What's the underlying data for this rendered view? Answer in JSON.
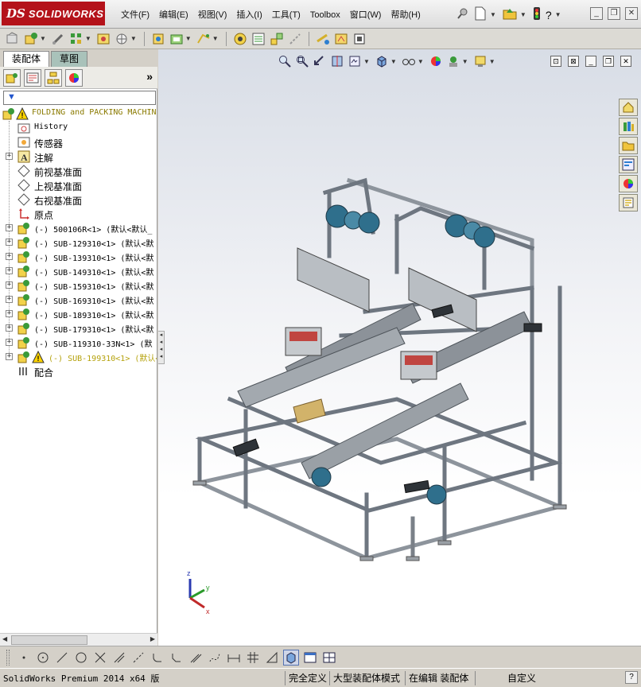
{
  "app": {
    "logo_ds": "DS",
    "logo_text": "SOLIDWORKS"
  },
  "menu": {
    "items": [
      {
        "label": "文件(F)"
      },
      {
        "label": "编辑(E)"
      },
      {
        "label": "视图(V)"
      },
      {
        "label": "插入(I)"
      },
      {
        "label": "工具(T)"
      },
      {
        "label": "Toolbox"
      },
      {
        "label": "窗口(W)"
      },
      {
        "label": "帮助(H)"
      }
    ]
  },
  "left_panel": {
    "tabs": [
      {
        "label": "装配体"
      },
      {
        "label": "草图"
      }
    ],
    "more_label": "»",
    "tree": [
      {
        "label": "FOLDING and PACKING MACHINE",
        "icon": "assembly-icon",
        "warning": true,
        "root": true
      },
      {
        "label": "History",
        "icon": "history-icon"
      },
      {
        "label": "传感器",
        "icon": "sensor-icon"
      },
      {
        "label": "注解",
        "icon": "annotation-icon",
        "expandable": true
      },
      {
        "label": "前视基准面",
        "icon": "plane-icon"
      },
      {
        "label": "上视基准面",
        "icon": "plane-icon"
      },
      {
        "label": "右视基准面",
        "icon": "plane-icon"
      },
      {
        "label": "原点",
        "icon": "origin-icon"
      },
      {
        "label": "(-) 500106R<1> (默认<默认_",
        "icon": "subassembly-icon",
        "expandable": true
      },
      {
        "label": "(-) SUB-129310<1> (默认<默",
        "icon": "subassembly-icon",
        "expandable": true
      },
      {
        "label": "(-) SUB-139310<1> (默认<默",
        "icon": "subassembly-icon",
        "expandable": true
      },
      {
        "label": "(-) SUB-149310<1> (默认<默",
        "icon": "subassembly-icon",
        "expandable": true
      },
      {
        "label": "(-) SUB-159310<1> (默认<默",
        "icon": "subassembly-icon",
        "expandable": true
      },
      {
        "label": "(-) SUB-169310<1> (默认<默",
        "icon": "subassembly-icon",
        "expandable": true
      },
      {
        "label": "(-) SUB-189310<1> (默认<默",
        "icon": "subassembly-icon",
        "expandable": true
      },
      {
        "label": "(-) SUB-179310<1> (默认<默",
        "icon": "subassembly-icon",
        "expandable": true
      },
      {
        "label": "(-) SUB-119310-33N<1> (默",
        "icon": "subassembly-icon",
        "expandable": true
      },
      {
        "label": "(-) SUB-199310<1> (默认<",
        "icon": "subassembly-icon",
        "expandable": true,
        "warning": true
      },
      {
        "label": "配合",
        "icon": "mates-icon"
      }
    ]
  },
  "triad": {
    "x": "x",
    "y": "y",
    "z": "z"
  },
  "status_bar": {
    "app_version": "SolidWorks Premium 2014 x64 版",
    "fully_defined": "完全定义",
    "large_assembly_mode": "大型装配体模式",
    "editing": "在编辑 装配体",
    "custom": "自定义",
    "help": "?"
  },
  "colors": {
    "brand_red": "#b4121a",
    "machine_blue": "#2f6f8c",
    "frame_gray": "#9aa0a8"
  }
}
